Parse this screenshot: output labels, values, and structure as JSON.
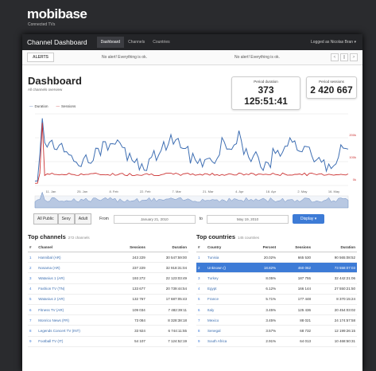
{
  "brand": {
    "logo": "mobibase",
    "tagline": "Connected TVs"
  },
  "nav": {
    "title": "Channel Dashboard",
    "tabs": [
      {
        "label": "Dashboard"
      },
      {
        "label": "Channels"
      },
      {
        "label": "Countries"
      }
    ],
    "user": "Logged as Nicolas Bran ▾"
  },
  "alerts": {
    "label": "ALERTS",
    "messages": [
      "No alert! Everything is ok.",
      "No alert! Everything is ok."
    ],
    "pager": [
      "<",
      "||",
      ">"
    ]
  },
  "header": {
    "title": "Dashboard",
    "subtitle": "All channels overview"
  },
  "stats": {
    "duration": {
      "label": "Period duration",
      "value": "373 125:51:41"
    },
    "sessions": {
      "label": "Period sessions",
      "value": "2 420 667"
    }
  },
  "chart_data": {
    "type": "line",
    "series": [
      {
        "name": "Duration",
        "color": "#3f6fb3"
      },
      {
        "name": "Sessions",
        "color": "#cc3333"
      }
    ],
    "x_ticks": [
      "11. Jan",
      "25. Jan",
      "8. Feb",
      "22. Feb",
      "7. Mar",
      "21. Mar",
      "4. Apr",
      "18. Apr",
      "2. May",
      "16. May"
    ],
    "right_ticks": [
      "200k",
      "100k",
      "0k"
    ]
  },
  "filters": {
    "buttons": [
      "All Public",
      "Sexy",
      "Adult"
    ],
    "from_label": "From",
    "from_value": "January 21, 2010",
    "to_label": "to",
    "to_value": "May 19, 2010",
    "display_label": "Display ▾"
  },
  "channels": {
    "title": "Top channels",
    "count": "272 channels",
    "columns": [
      "#",
      "Channel",
      "Sessions",
      "Duration"
    ],
    "rows": [
      [
        "1",
        "Hannibal (AR)",
        "243 229",
        "30 547:59:00"
      ],
      [
        "2",
        "Nosama (AR)",
        "237 229",
        "32 918:31:04"
      ],
      [
        "3",
        "Watanius 1 (AR)",
        "193 272",
        "22 123:03:49"
      ],
      [
        "4",
        "Fashion TV (TN)",
        "133 677",
        "20 739:44:54"
      ],
      [
        "5",
        "Watanius 2 (AR)",
        "132 767",
        "17 687:05:43"
      ],
      [
        "6",
        "Fitness TV (AR)",
        "109 034",
        "7 482:39:11"
      ],
      [
        "7",
        "Monrico News (FR)",
        "73 084",
        "8 328:38:18"
      ],
      [
        "8",
        "Legends Concert TV (INT)",
        "33 924",
        "6 744:11:55"
      ],
      [
        "9",
        "Football TV (IT)",
        "54 107",
        "7 124:52:19"
      ]
    ]
  },
  "countries": {
    "title": "Top countries",
    "count": "145 countries",
    "columns": [
      "#",
      "Country",
      "Percent",
      "Sessions",
      "Duration"
    ],
    "rows": [
      [
        "1",
        "Tunisia",
        "20.02%",
        "665 530",
        "90 565:08:52"
      ],
      [
        "2",
        "Unknown ()",
        "18.82%",
        "460 062",
        "73 558:07:03"
      ],
      [
        "3",
        "Turkey",
        "8.05%",
        "187 755",
        "32 442:21:06"
      ],
      [
        "4",
        "Egypt",
        "6.12%",
        "166 144",
        "27 550:21:50"
      ],
      [
        "5",
        "France",
        "5.71%",
        "177 448",
        "8 370:15:24"
      ],
      [
        "6",
        "Italy",
        "3.45%",
        "125 436",
        "20 454:03:02"
      ],
      [
        "7",
        "Mexico",
        "3.45%",
        "88 021",
        "24 174:57:58"
      ],
      [
        "8",
        "Senegal",
        "3.57%",
        "68 732",
        "12 199:26:15"
      ],
      [
        "9",
        "South Africa",
        "2.91%",
        "64 013",
        "10 468:50:31"
      ]
    ]
  }
}
